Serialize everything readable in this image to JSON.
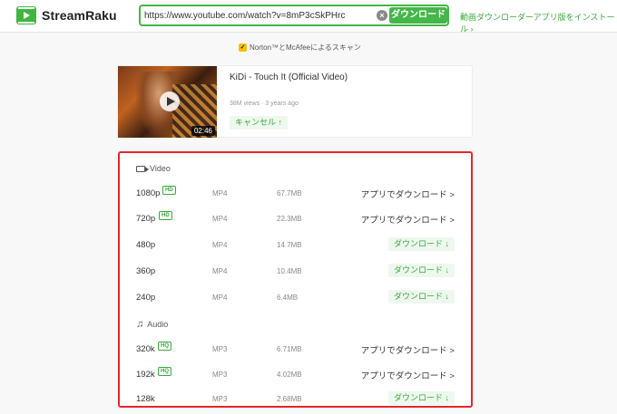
{
  "header": {
    "logo_text": "StreamRaku",
    "search_value": "https://www.youtube.com/watch?v=8mP3cSkPHrc",
    "clear_symbol": "×",
    "download_label": "ダウンロード",
    "install_link": "動画ダウンローダーアプリ版をインストール ›"
  },
  "scan": {
    "check_symbol": "✓",
    "text": "Norton™とMcAfeeによるスキャン"
  },
  "video": {
    "title": "KiDi - Touch It (Official Video)",
    "meta": "38M views · 3 years ago",
    "duration": "02:46",
    "cancel_label": "キャンセル ↑"
  },
  "sections": {
    "video_label": "Video",
    "audio_label": "Audio"
  },
  "video_rows": [
    {
      "res": "1080p",
      "badge": "HD",
      "fmt": "MP4",
      "size": "67.7MB",
      "action": "アプリでダウンロード >"
    },
    {
      "res": "720p",
      "badge": "HD",
      "fmt": "MP4",
      "size": "22.3MB",
      "action": "アプリでダウンロード >"
    },
    {
      "res": "480p",
      "badge": "",
      "fmt": "MP4",
      "size": "14.7MB",
      "action": "ダウンロード ↓"
    },
    {
      "res": "360p",
      "badge": "",
      "fmt": "MP4",
      "size": "10.4MB",
      "action": "ダウンロード ↓"
    },
    {
      "res": "240p",
      "badge": "",
      "fmt": "MP4",
      "size": "6.4MB",
      "action": "ダウンロード ↓"
    }
  ],
  "audio_rows": [
    {
      "res": "320k",
      "badge": "HQ",
      "fmt": "MP3",
      "size": "6.71MB",
      "action": "アプリでダウンロード >"
    },
    {
      "res": "192k",
      "badge": "HQ",
      "fmt": "MP3",
      "size": "4.02MB",
      "action": "アプリでダウンロード >"
    },
    {
      "res": "128k",
      "badge": "",
      "fmt": "MP3",
      "size": "2.68MB",
      "action": "ダウンロード ↓"
    }
  ],
  "colors": {
    "accent": "#45b649",
    "highlight_border": "#e8262d"
  }
}
